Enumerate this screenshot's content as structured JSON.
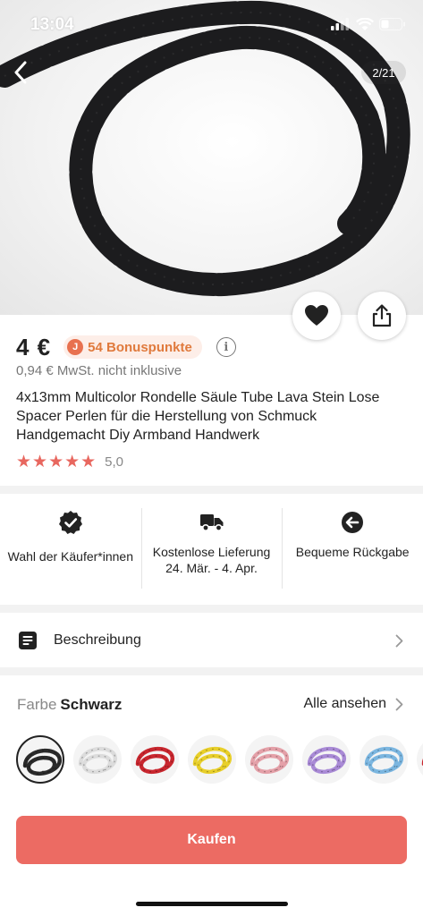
{
  "status_bar": {
    "time": "13:04"
  },
  "gallery": {
    "counter": "2/21"
  },
  "product": {
    "price": "4 €",
    "bonus_points": "54 Bonuspunkte",
    "bonus_coin": "J",
    "vat_note": "0,94 € MwSt. nicht inklusive",
    "title": "4x13mm Multicolor Rondelle Säule Tube Lava Stein Lose Spacer Perlen für die Herstellung von Schmuck Handgemacht Diy Armband Handwerk",
    "stars": "★★★★★",
    "rating": "5,0"
  },
  "features": [
    {
      "icon": "verified-badge-icon",
      "label": "Wahl der Käufer*innen"
    },
    {
      "icon": "truck-icon",
      "label": "Kostenlose Lieferung 24. Mär. - 4. Apr."
    },
    {
      "icon": "return-arrow-icon",
      "label": "Bequeme Rückgabe"
    }
  ],
  "description": {
    "label": "Beschreibung"
  },
  "color": {
    "label": "Farbe",
    "selected": "Schwarz",
    "see_all": "Alle ansehen",
    "swatch_colors": [
      "#2a2a2a",
      "#e8e8e8",
      "#c9272f",
      "#e8cf2a",
      "#e4a0a8",
      "#a98ad6",
      "#7bb6e0",
      "#c9272f"
    ]
  },
  "buy": {
    "label": "Kaufen"
  },
  "colors": {
    "accent": "#ec6b63",
    "star": "#e8675f",
    "bonus_text": "#e07a3d"
  }
}
